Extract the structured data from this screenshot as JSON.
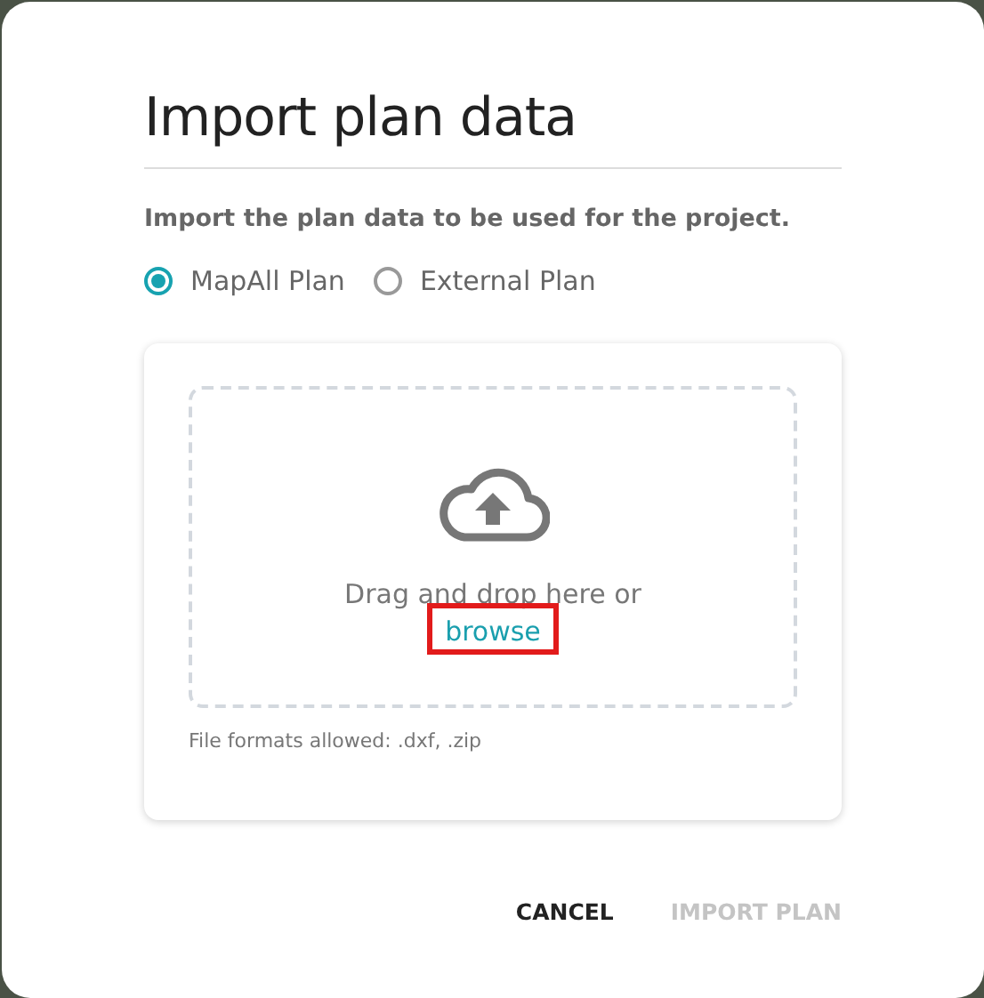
{
  "dialog": {
    "title": "Import plan data",
    "description": "Import the plan data to be used for the project.",
    "plan_types": [
      {
        "label": "MapAll Plan",
        "selected": true
      },
      {
        "label": "External Plan",
        "selected": false
      }
    ],
    "dropzone": {
      "prompt": "Drag and drop here or",
      "link": "browse",
      "link_highlighted": true
    },
    "formats_note": "File formats allowed: .dxf, .zip",
    "buttons": [
      {
        "label": "CANCEL",
        "disabled": false
      },
      {
        "label": "IMPORT PLAN",
        "disabled": true
      }
    ]
  }
}
